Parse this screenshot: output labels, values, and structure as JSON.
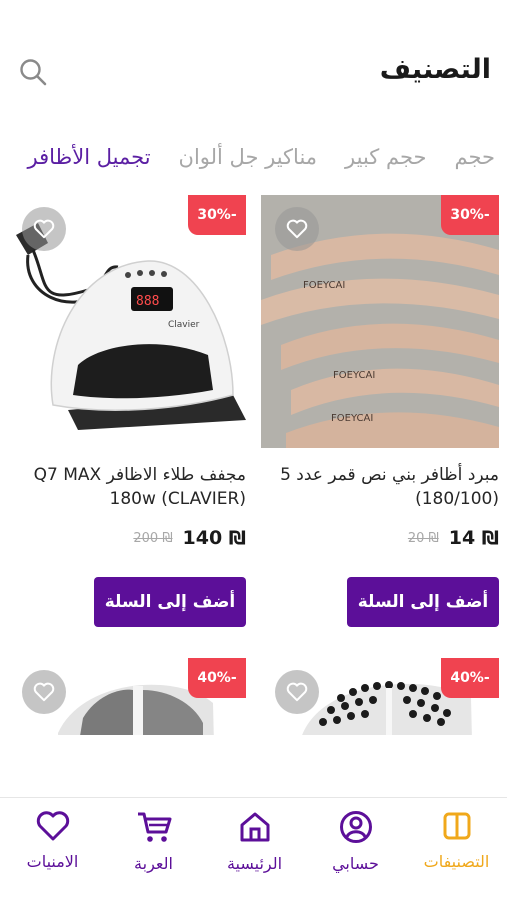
{
  "header": {
    "title": "التصنيف",
    "search_icon": "search-icon"
  },
  "tabs": [
    {
      "label": "تجميل الأظافر",
      "active": true
    },
    {
      "label": "مناكير جل ألوان",
      "active": false
    },
    {
      "label": "حجم كبير",
      "active": false
    },
    {
      "label": "حجم",
      "active": false
    }
  ],
  "products": [
    {
      "discount": "30%-",
      "name": "مبرد أظافر بني نص قمر عدد 5  (180/100)",
      "price": "14 ₪",
      "old_price": "20 ₪",
      "button": "أضف إلى السلة",
      "favorite_icon": "heart-outline-icon",
      "image_brand": "FOEYCAI"
    },
    {
      "discount": "30%-",
      "name": "مجفف طلاء الاظافر Q7 MAX 180w (CLAVIER)",
      "price": "140 ₪",
      "old_price": "200 ₪",
      "button": "أضف إلى السلة",
      "favorite_icon": "heart-outline-icon",
      "image_brand": "Clavier",
      "image_display": "888"
    },
    {
      "discount": "40%-",
      "favorite_icon": "heart-outline-icon"
    },
    {
      "discount": "40%-",
      "favorite_icon": "heart-outline-icon"
    }
  ],
  "bottom_nav": {
    "items": [
      {
        "label": "التصنيفات",
        "icon": "categories-icon",
        "active": true
      },
      {
        "label": "حسابي",
        "icon": "account-icon",
        "active": false
      },
      {
        "label": "الرئيسية",
        "icon": "home-icon",
        "active": false
      },
      {
        "label": "العربة",
        "icon": "cart-icon",
        "active": false
      },
      {
        "label": "الامنيات",
        "icon": "heart-icon",
        "active": false
      }
    ]
  },
  "colors": {
    "primary": "#5c0f99",
    "discount": "#f04350",
    "active_nav": "#f0a81b",
    "active_tab": "#5b1fa3"
  }
}
